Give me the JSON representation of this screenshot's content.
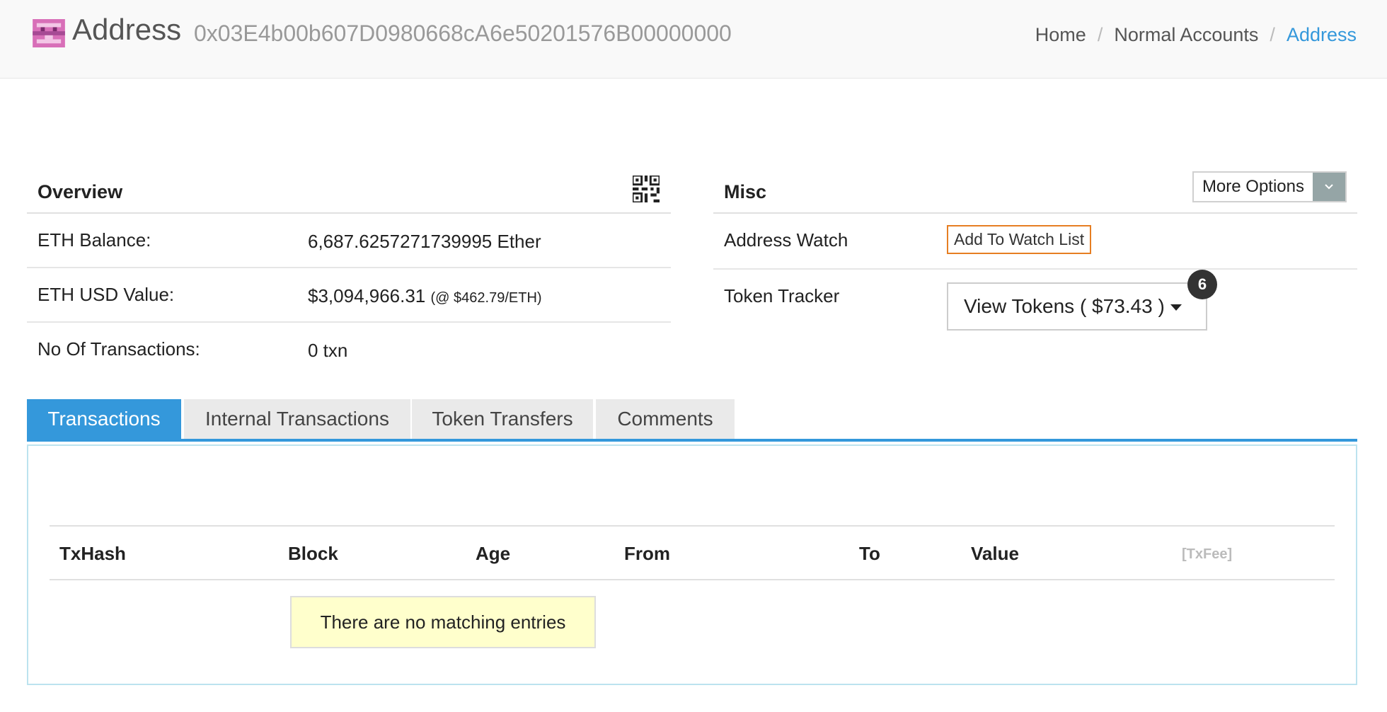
{
  "header": {
    "title": "Address",
    "address": "0x03E4b00b607D0980668cA6e50201576B00000000",
    "breadcrumb": [
      "Home",
      "Normal Accounts",
      "Address"
    ]
  },
  "overview": {
    "title": "Overview",
    "rows": [
      {
        "label": "ETH Balance:",
        "value": "6,687.6257271739995 Ether",
        "note": ""
      },
      {
        "label": "ETH USD Value:",
        "value": "$3,094,966.31",
        "note": "(@ $462.79/ETH)"
      },
      {
        "label": "No Of Transactions:",
        "value": "0 txn",
        "note": ""
      }
    ]
  },
  "misc": {
    "title": "Misc",
    "more_options": "More Options",
    "address_watch_label": "Address Watch",
    "add_watch_button": "Add To Watch List",
    "token_tracker_label": "Token Tracker",
    "view_tokens_button": "View Tokens ( $73.43 )",
    "token_count": "6"
  },
  "tabs": [
    "Transactions",
    "Internal Transactions",
    "Token Transfers",
    "Comments"
  ],
  "table": {
    "columns": [
      "TxHash",
      "Block",
      "Age",
      "From",
      "To",
      "Value",
      "[TxFee]"
    ],
    "empty_message": "There are no matching entries"
  },
  "colors": {
    "accent": "#3498db",
    "watch_border": "#e67e22",
    "empty_bg": "#ffffcc"
  }
}
